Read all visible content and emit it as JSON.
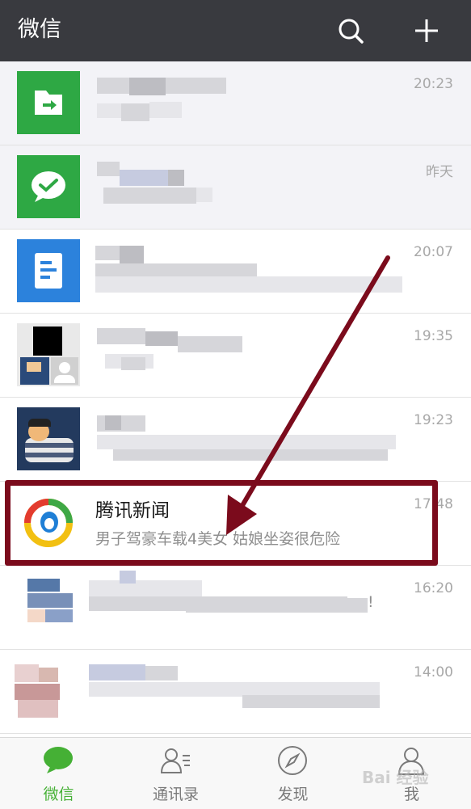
{
  "header": {
    "title": "微信",
    "icons": [
      "search-icon",
      "plus-icon"
    ]
  },
  "chats": [
    {
      "time": "20:23",
      "avatar": "file-transfer-icon",
      "accent": "#2ea844"
    },
    {
      "time": "昨天",
      "avatar": "wechat-logo-icon",
      "accent": "#2ea844"
    },
    {
      "time": "20:07",
      "avatar": "document-icon",
      "accent": "#2c82dc"
    },
    {
      "time": "19:35",
      "avatar": "group-avatar"
    },
    {
      "time": "19:23",
      "avatar": "cartoon-avatar"
    },
    {
      "time": "17:48",
      "name": "腾讯新闻",
      "preview": "男子驾豪车载4美女 姑娘坐姿很危险",
      "avatar": "tencent-news-icon"
    },
    {
      "time": "16:20",
      "avatar": "blurred-avatar",
      "preview_end": "!"
    },
    {
      "time": "14:00",
      "avatar": "blurred-avatar"
    }
  ],
  "tabs": [
    {
      "label": "微信",
      "icon": "chat-bubble-icon",
      "active": true
    },
    {
      "label": "通讯录",
      "icon": "contacts-icon",
      "active": false
    },
    {
      "label": "发现",
      "icon": "compass-icon",
      "active": false
    },
    {
      "label": "我",
      "icon": "person-icon",
      "active": false
    }
  ],
  "watermark": "Bai 经验",
  "colors": {
    "header_bg": "#393a3f",
    "active_tab": "#45b035",
    "annotation": "#7b0b1c"
  }
}
